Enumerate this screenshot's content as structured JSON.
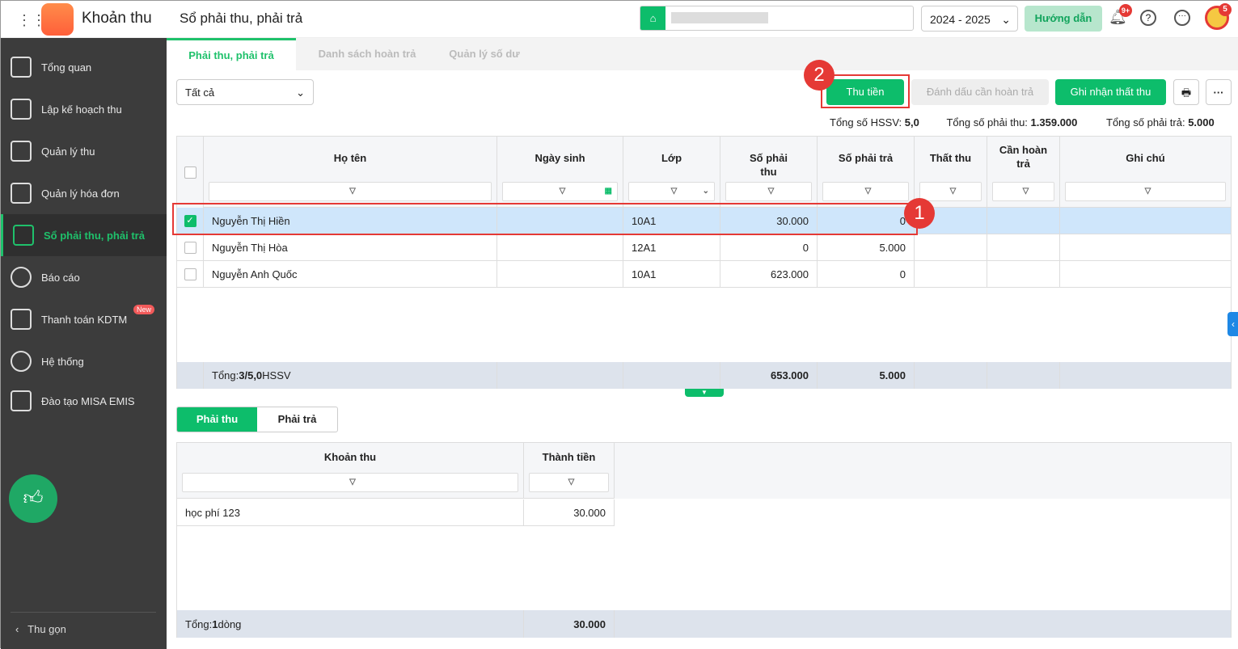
{
  "app": {
    "name": "Khoản thu",
    "page_title": "Sổ phải thu, phải trả",
    "year": "2024 - 2025",
    "guide": "Hướng dẫn",
    "notif_badge": "9+",
    "avatar_badge": "5"
  },
  "sidebar": {
    "items": [
      {
        "label": "Tổng quan"
      },
      {
        "label": "Lập kế hoạch thu"
      },
      {
        "label": "Quản lý thu"
      },
      {
        "label": "Quản lý hóa đơn"
      },
      {
        "label": "Sổ phải thu, phải trả",
        "active": true
      },
      {
        "label": "Báo cáo"
      },
      {
        "label": "Thanh toán KDTM",
        "badge": "New"
      },
      {
        "label": "Hệ thống"
      },
      {
        "label": "Đào tạo MISA EMIS"
      }
    ],
    "collapse": "Thu gọn"
  },
  "tabs": [
    "Phải thu, phải trả",
    "Danh sách hoàn trả",
    "Quản lý số dư"
  ],
  "filter": {
    "value": "Tất cả"
  },
  "toolbar": {
    "collect": "Thu tiền",
    "mark_refund": "Đánh dấu cần hoàn trả",
    "record_loss": "Ghi nhận thất thu"
  },
  "summary": {
    "students_label": "Tổng số HSSV:",
    "students": "5,0",
    "receivable_label": "Tổng số phải thu:",
    "receivable": "1.359.000",
    "payable_label": "Tổng số phải trả:",
    "payable": "5.000"
  },
  "table": {
    "columns": [
      "Họ tên",
      "Ngày sinh",
      "Lớp",
      "Số phải thu",
      "Số phải trả",
      "Thất thu",
      "Cần hoàn trả",
      "Ghi chú"
    ],
    "rows": [
      {
        "name": "Nguyễn Thị Hiền",
        "dob": "",
        "class": "10A1",
        "receivable": "30.000",
        "payable": "0",
        "checked": true
      },
      {
        "name": "Nguyễn Thị Hòa",
        "dob": "",
        "class": "12A1",
        "receivable": "0",
        "payable": "5.000",
        "checked": false
      },
      {
        "name": "Nguyễn Anh Quốc",
        "dob": "",
        "class": "10A1",
        "receivable": "623.000",
        "payable": "0",
        "checked": false
      }
    ],
    "footer": {
      "label": "Tổng: ",
      "count": "3/5,0",
      "unit": " HSSV",
      "receivable": "653.000",
      "payable": "5.000"
    }
  },
  "annotations": [
    "1",
    "2"
  ],
  "detail": {
    "tabs": [
      "Phải thu",
      "Phải trả"
    ],
    "columns": [
      "Khoản thu",
      "Thành tiền"
    ],
    "rows": [
      {
        "item": "học phí 123",
        "amount": "30.000"
      }
    ],
    "footer": {
      "label": "Tổng: ",
      "count": "1",
      "unit": " dòng",
      "amount": "30.000"
    }
  },
  "colors": {
    "accent": "#0dbd6b",
    "sidebar": "#3c3c3c",
    "highlight": "#e53935",
    "selected_row": "#cfe6fb"
  }
}
